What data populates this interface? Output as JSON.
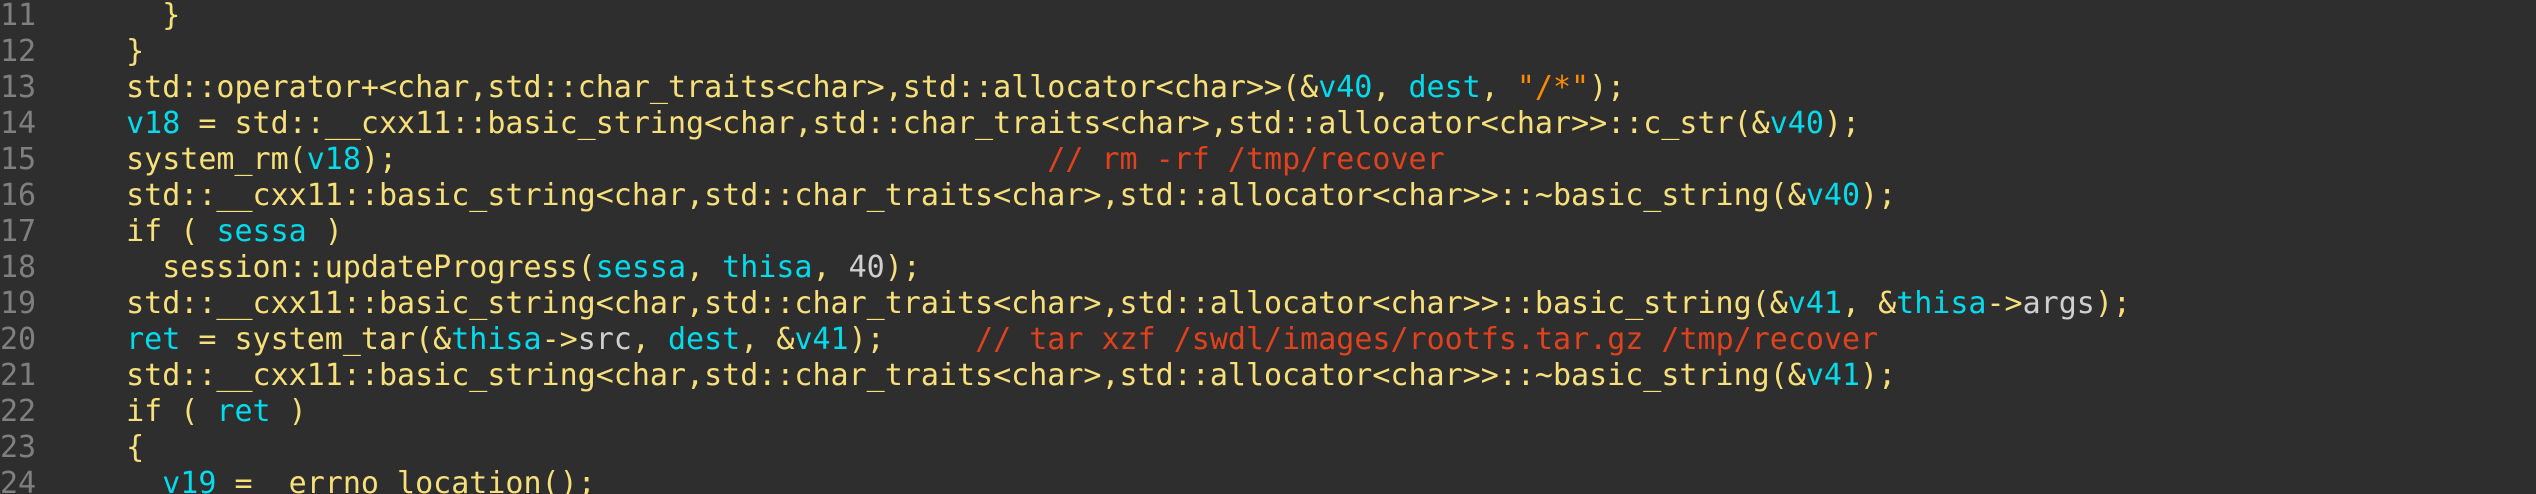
{
  "editor": {
    "lines": [
      {
        "num": "11",
        "tokens": [
          {
            "t": "    }",
            "c": "y"
          }
        ]
      },
      {
        "num": "12",
        "tokens": [
          {
            "t": "  }",
            "c": "y"
          }
        ]
      },
      {
        "num": "13",
        "tokens": [
          {
            "t": "  std::operator+<char,std::char_traits<char>,std::allocator<char>>(&",
            "c": "y"
          },
          {
            "t": "v40",
            "c": "c"
          },
          {
            "t": ", ",
            "c": "y"
          },
          {
            "t": "dest",
            "c": "c"
          },
          {
            "t": ", ",
            "c": "y"
          },
          {
            "t": "\"/*\"",
            "c": "s"
          },
          {
            "t": ");",
            "c": "y"
          }
        ]
      },
      {
        "num": "14",
        "tokens": [
          {
            "t": "  ",
            "c": "y"
          },
          {
            "t": "v18",
            "c": "c"
          },
          {
            "t": " = std::__cxx11::basic_string<char,std::char_traits<char>,std::allocator<char>>::c_str(&",
            "c": "y"
          },
          {
            "t": "v40",
            "c": "c"
          },
          {
            "t": ");",
            "c": "y"
          }
        ]
      },
      {
        "num": "15",
        "tokens": [
          {
            "t": "  system_rm(",
            "c": "y"
          },
          {
            "t": "v18",
            "c": "c"
          },
          {
            "t": ");                                    ",
            "c": "y"
          },
          {
            "t": "// rm -rf /tmp/recover",
            "c": "m"
          }
        ]
      },
      {
        "num": "16",
        "tokens": [
          {
            "t": "  std::__cxx11::basic_string<char,std::char_traits<char>,std::allocator<char>>::~basic_string(&",
            "c": "y"
          },
          {
            "t": "v40",
            "c": "c"
          },
          {
            "t": ");",
            "c": "y"
          }
        ]
      },
      {
        "num": "17",
        "tokens": [
          {
            "t": "  if ( ",
            "c": "y"
          },
          {
            "t": "sessa",
            "c": "c"
          },
          {
            "t": " )",
            "c": "y"
          }
        ]
      },
      {
        "num": "18",
        "tokens": [
          {
            "t": "    session::updateProgress(",
            "c": "y"
          },
          {
            "t": "sessa",
            "c": "c"
          },
          {
            "t": ", ",
            "c": "y"
          },
          {
            "t": "thisa",
            "c": "c"
          },
          {
            "t": ", ",
            "c": "y"
          },
          {
            "t": "40",
            "c": "g"
          },
          {
            "t": ");",
            "c": "y"
          }
        ]
      },
      {
        "num": "19",
        "tokens": [
          {
            "t": "  std::__cxx11::basic_string<char,std::char_traits<char>,std::allocator<char>>::basic_string(&",
            "c": "y"
          },
          {
            "t": "v41",
            "c": "c"
          },
          {
            "t": ", &",
            "c": "y"
          },
          {
            "t": "thisa",
            "c": "c"
          },
          {
            "t": "->",
            "c": "y"
          },
          {
            "t": "args",
            "c": "g"
          },
          {
            "t": ");",
            "c": "y"
          }
        ]
      },
      {
        "num": "20",
        "tokens": [
          {
            "t": "  ",
            "c": "y"
          },
          {
            "t": "ret",
            "c": "c"
          },
          {
            "t": " = system_tar(&",
            "c": "y"
          },
          {
            "t": "thisa",
            "c": "c"
          },
          {
            "t": "->",
            "c": "y"
          },
          {
            "t": "src",
            "c": "g"
          },
          {
            "t": ", ",
            "c": "y"
          },
          {
            "t": "dest",
            "c": "c"
          },
          {
            "t": ", &",
            "c": "y"
          },
          {
            "t": "v41",
            "c": "c"
          },
          {
            "t": ");     ",
            "c": "y"
          },
          {
            "t": "// tar xzf /swdl/images/rootfs.tar.gz /tmp/recover",
            "c": "m"
          }
        ]
      },
      {
        "num": "21",
        "tokens": [
          {
            "t": "  std::__cxx11::basic_string<char,std::char_traits<char>,std::allocator<char>>::~basic_string(&",
            "c": "y"
          },
          {
            "t": "v41",
            "c": "c"
          },
          {
            "t": ");",
            "c": "y"
          }
        ]
      },
      {
        "num": "22",
        "tokens": [
          {
            "t": "  if ( ",
            "c": "y"
          },
          {
            "t": "ret",
            "c": "c"
          },
          {
            "t": " )",
            "c": "y"
          }
        ]
      },
      {
        "num": "23",
        "tokens": [
          {
            "t": "  {",
            "c": "y"
          }
        ]
      },
      {
        "num": "24",
        "tokens": [
          {
            "t": "    ",
            "c": "y"
          },
          {
            "t": "v19",
            "c": "c"
          },
          {
            "t": " = _errno_location();",
            "c": "y"
          }
        ]
      }
    ]
  }
}
